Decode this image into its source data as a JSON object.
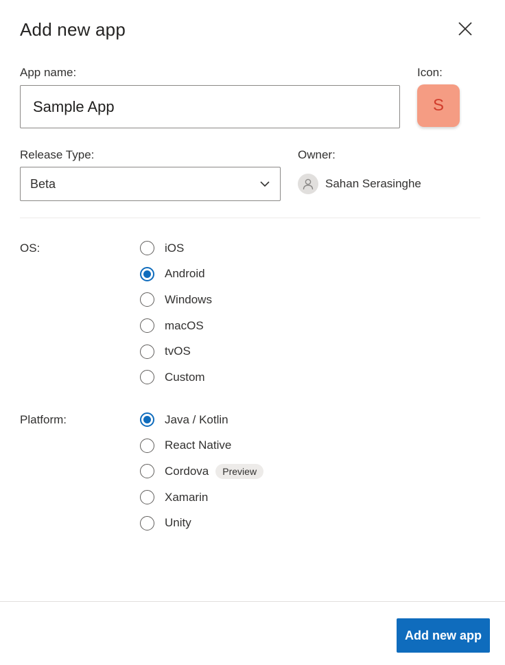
{
  "dialog": {
    "title": "Add new app",
    "close_icon": "close-icon"
  },
  "app_name": {
    "label": "App name:",
    "value": "Sample App"
  },
  "icon": {
    "label": "Icon:",
    "letter": "S",
    "color": "#f59c83"
  },
  "release_type": {
    "label": "Release Type:",
    "selected": "Beta",
    "icon": "chevron-down-icon"
  },
  "owner": {
    "label": "Owner:",
    "name": "Sahan Serasinghe",
    "avatar_icon": "person-icon"
  },
  "os": {
    "label": "OS:",
    "options": [
      {
        "label": "iOS",
        "checked": false
      },
      {
        "label": "Android",
        "checked": true
      },
      {
        "label": "Windows",
        "checked": false
      },
      {
        "label": "macOS",
        "checked": false
      },
      {
        "label": "tvOS",
        "checked": false
      },
      {
        "label": "Custom",
        "checked": false
      }
    ]
  },
  "platform": {
    "label": "Platform:",
    "options": [
      {
        "label": "Java / Kotlin",
        "checked": true
      },
      {
        "label": "React Native",
        "checked": false
      },
      {
        "label": "Cordova",
        "checked": false,
        "badge": "Preview"
      },
      {
        "label": "Xamarin",
        "checked": false
      },
      {
        "label": "Unity",
        "checked": false
      }
    ]
  },
  "footer": {
    "submit_label": "Add new app"
  },
  "colors": {
    "accent": "#0f6cbd",
    "icon_background": "#f59c83"
  }
}
